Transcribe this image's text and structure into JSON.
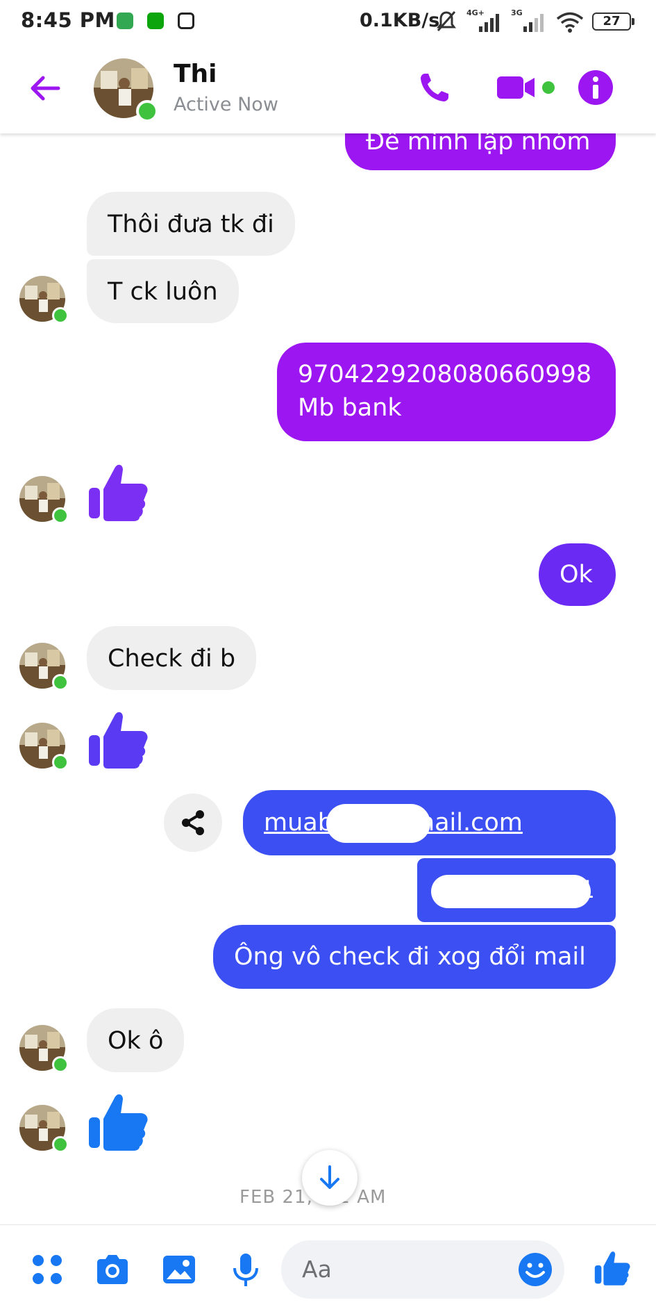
{
  "status_bar": {
    "time": "8:45 PM",
    "net_speed": "0.1KB/s",
    "signal_1": "4G+",
    "signal_2": "3G",
    "battery": "27"
  },
  "header": {
    "name": "Thi",
    "status": "Active Now",
    "accent": "#9b16f0"
  },
  "messages": {
    "m0": "Để mình lập nhóm",
    "m1": "Thôi đưa tk đi",
    "m2": "T ck luôn",
    "m3_line1": "9704229208080660998",
    "m3_line2": "Mb bank",
    "m4": "Ok",
    "m5": "Check đi b",
    "m6": "muaba        8@gmail.com",
    "m7": "1",
    "m8": "Ông vô check đi xog đổi mail",
    "m9": "Ok ô"
  },
  "timestamp": "FEB 21,   :12 AM",
  "composer": {
    "placeholder": "Aa"
  },
  "icons": [
    "back-arrow-icon",
    "phone-icon",
    "video-icon",
    "info-icon",
    "share-icon",
    "arrow-down-icon",
    "apps-icon",
    "camera-icon",
    "gallery-icon",
    "microphone-icon",
    "emoji-icon",
    "thumbs-up-icon"
  ]
}
